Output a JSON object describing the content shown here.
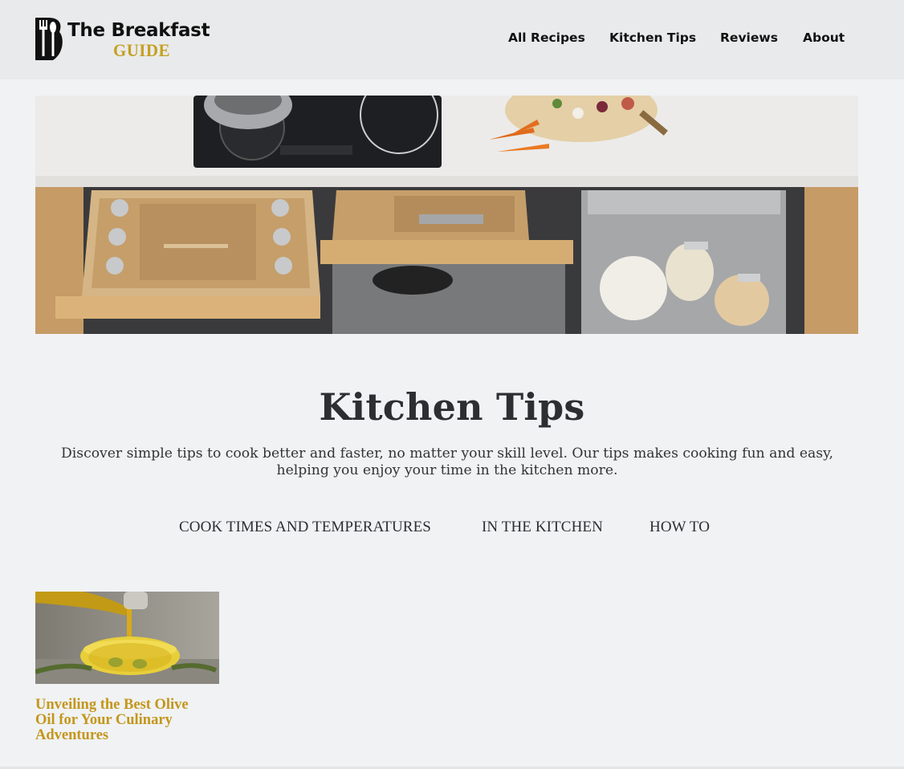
{
  "brand": {
    "title": "The Breakfast",
    "subtitle": "GUIDE",
    "accent": "#c4a020"
  },
  "nav": {
    "items": [
      {
        "label": "All Recipes"
      },
      {
        "label": "Kitchen Tips"
      },
      {
        "label": "Reviews"
      },
      {
        "label": "About"
      }
    ]
  },
  "hero": {
    "description": "kitchen-drawers-photo"
  },
  "page": {
    "title": "Kitchen Tips",
    "intro": "Discover simple tips to cook better and faster, no matter your skill level. Our tips makes cooking fun and easy, helping you enjoy your time in the kitchen more."
  },
  "categories": [
    {
      "label": "COOK TIMES AND TEMPERATURES"
    },
    {
      "label": "IN THE KITCHEN"
    },
    {
      "label": "HOW TO"
    }
  ],
  "posts": [
    {
      "title": "Unveiling the Best Olive Oil for Your Culinary Adventures",
      "color": "#c4961a"
    }
  ]
}
